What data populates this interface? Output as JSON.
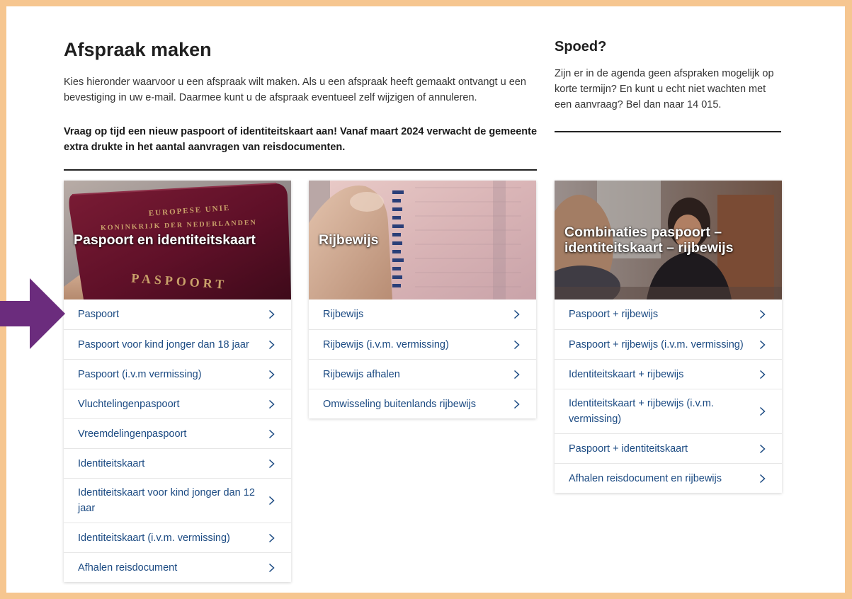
{
  "main": {
    "title": "Afspraak maken",
    "intro": "Kies hieronder waarvoor u een afspraak wilt maken. Als u een afspraak heeft gemaakt ontvangt u een bevestiging in uw e-mail. Daarmee kunt u de afspraak eventueel zelf wijzigen of annuleren.",
    "notice": "Vraag op tijd een nieuw paspoort of identiteitskaart aan! Vanaf maart 2024 verwacht de gemeente extra drukte in het aantal aanvragen van reisdocumenten."
  },
  "side": {
    "title": "Spoed?",
    "text": "Zijn er in de agenda geen afspraken mogelijk op korte termijn? En kunt u echt niet wachten met een aanvraag? Bel dan naar 14 015."
  },
  "cards": [
    {
      "title": "Paspoort en identiteitskaart",
      "image_text": {
        "line1": "EUROPESE UNIE",
        "line2": "KONINKRIJK DER NEDERLANDEN",
        "line3": "PASPOORT"
      },
      "items": [
        {
          "label": "Paspoort"
        },
        {
          "label": "Paspoort voor kind jonger dan 18 jaar"
        },
        {
          "label": "Paspoort (i.v.m vermissing)"
        },
        {
          "label": "Vluchtelingenpaspoort"
        },
        {
          "label": "Vreemdelingenpaspoort"
        },
        {
          "label": "Identiteitskaart"
        },
        {
          "label": "Identiteitskaart voor kind jonger dan 12 jaar"
        },
        {
          "label": "Identiteitskaart (i.v.m. vermissing)"
        },
        {
          "label": "Afhalen reisdocument"
        }
      ]
    },
    {
      "title": "Rijbewijs",
      "items": [
        {
          "label": "Rijbewijs"
        },
        {
          "label": "Rijbewijs (i.v.m. vermissing)"
        },
        {
          "label": "Rijbewijs afhalen"
        },
        {
          "label": "Omwisseling buitenlands rijbewijs"
        }
      ]
    },
    {
      "title": "Combinaties paspoort – identiteitskaart – rijbewijs",
      "items": [
        {
          "label": "Paspoort + rijbewijs"
        },
        {
          "label": "Paspoort + rijbewijs (i.v.m. vermissing)"
        },
        {
          "label": "Identiteitskaart + rijbewijs"
        },
        {
          "label": "Identiteitskaart + rijbewijs (i.v.m. vermissing)"
        },
        {
          "label": "Paspoort + identiteitskaart"
        },
        {
          "label": "Afhalen reisdocument en rijbewijs"
        }
      ]
    }
  ],
  "colors": {
    "page_border": "#f6c690",
    "link": "#1b4a82",
    "arrow": "#6b2c7d",
    "passport": "#6e1a32"
  },
  "icons": {
    "chevron": "chevron-right-icon",
    "pointer": "arrow-right-icon"
  }
}
